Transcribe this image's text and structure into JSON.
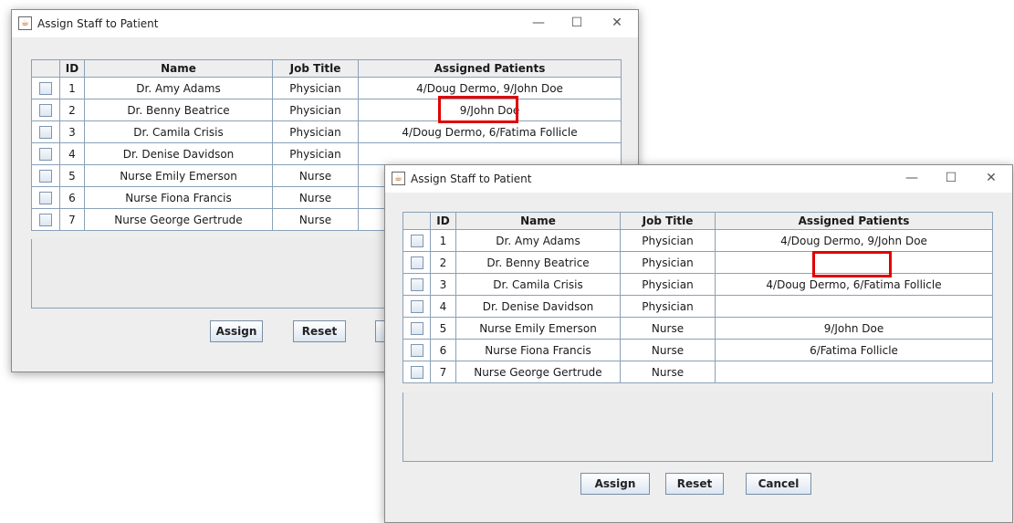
{
  "window_back": {
    "title": "Assign Staff to Patient",
    "columns": [
      "",
      "ID",
      "Name",
      "Job Title",
      "Assigned Patients"
    ],
    "rows": [
      {
        "id": "1",
        "name": "Dr. Amy Adams",
        "job": "Physician",
        "patients": "4/Doug Dermo, 9/John Doe"
      },
      {
        "id": "2",
        "name": "Dr. Benny Beatrice",
        "job": "Physician",
        "patients": "9/John Doe"
      },
      {
        "id": "3",
        "name": "Dr. Camila Crisis",
        "job": "Physician",
        "patients": "4/Doug Dermo, 6/Fatima Follicle"
      },
      {
        "id": "4",
        "name": "Dr. Denise Davidson",
        "job": "Physician",
        "patients": ""
      },
      {
        "id": "5",
        "name": "Nurse Emily Emerson",
        "job": "Nurse",
        "patients": ""
      },
      {
        "id": "6",
        "name": "Nurse Fiona Francis",
        "job": "Nurse",
        "patients": ""
      },
      {
        "id": "7",
        "name": "Nurse George Gertrude",
        "job": "Nurse",
        "patients": ""
      }
    ],
    "buttons": {
      "assign": "Assign",
      "reset": "Reset"
    }
  },
  "window_front": {
    "title": "Assign Staff to Patient",
    "columns": [
      "",
      "ID",
      "Name",
      "Job Title",
      "Assigned Patients"
    ],
    "rows": [
      {
        "id": "1",
        "name": "Dr. Amy Adams",
        "job": "Physician",
        "patients": "4/Doug Dermo, 9/John Doe"
      },
      {
        "id": "2",
        "name": "Dr. Benny Beatrice",
        "job": "Physician",
        "patients": ""
      },
      {
        "id": "3",
        "name": "Dr. Camila Crisis",
        "job": "Physician",
        "patients": "4/Doug Dermo, 6/Fatima Follicle"
      },
      {
        "id": "4",
        "name": "Dr. Denise Davidson",
        "job": "Physician",
        "patients": ""
      },
      {
        "id": "5",
        "name": "Nurse Emily Emerson",
        "job": "Nurse",
        "patients": "9/John Doe"
      },
      {
        "id": "6",
        "name": "Nurse Fiona Francis",
        "job": "Nurse",
        "patients": "6/Fatima Follicle"
      },
      {
        "id": "7",
        "name": "Nurse George Gertrude",
        "job": "Nurse",
        "patients": ""
      }
    ],
    "buttons": {
      "assign": "Assign",
      "reset": "Reset",
      "cancel": "Cancel"
    }
  },
  "window_controls": {
    "minimize": "—",
    "maximize": "☐",
    "close": "✕"
  },
  "icons": {
    "app": "java-app-icon"
  },
  "colors": {
    "highlight": "#e00000",
    "grid": "#8aa0b8"
  }
}
